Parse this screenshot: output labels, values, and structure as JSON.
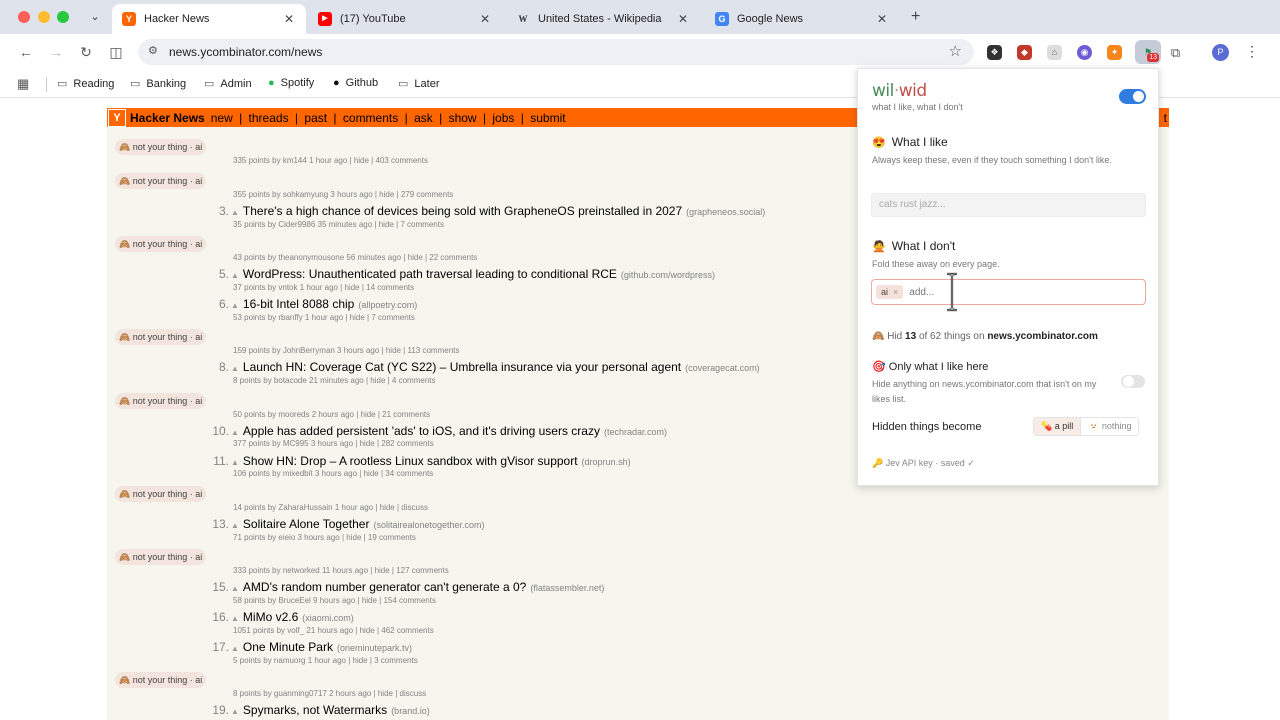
{
  "browser": {
    "tabs": [
      {
        "title": "Hacker News",
        "favicon": "Y",
        "favicon_color": "#ff6600",
        "active": true
      },
      {
        "title": "(17) YouTube",
        "favicon": "▶",
        "favicon_color": "#ff0000",
        "active": false
      },
      {
        "title": "United States - Wikipedia",
        "favicon": "W",
        "favicon_color": "#333333",
        "active": false
      },
      {
        "title": "Google News",
        "favicon": "G",
        "favicon_color": "#4285f4",
        "active": false
      }
    ],
    "url": "news.ycombinator.com/news",
    "bookmarks": [
      "Reading",
      "Banking",
      "Admin",
      "Spotify",
      "Github",
      "Later"
    ],
    "extension_badge": "13",
    "profile_initial": "P"
  },
  "hn": {
    "logo": "Y",
    "title": "Hacker News",
    "nav": [
      "new",
      "|",
      "threads",
      "|",
      "past",
      "|",
      "comments",
      "|",
      "ask",
      "|",
      "show",
      "|",
      "jobs",
      "|",
      "submit"
    ],
    "login": "t",
    "items": [
      {
        "pill": "🙈 not your thing · ai",
        "sub": "335 points by km144 1 hour ago | hide | 403 comments"
      },
      {
        "pill": "🙈 not your thing · ai",
        "sub": "355 points by sohkamyung 3 hours ago | hide | 279 comments"
      },
      {
        "rank": "3.",
        "title": "There's a high chance of devices being sold with GrapheneOS preinstalled in 2027",
        "domain": "(grapheneos.social)",
        "sub": "35 points by Cider9986 35 minutes ago | hide | 7 comments"
      },
      {
        "pill": "🙈 not your thing · ai",
        "sub": "43 points by theanonymousone 56 minutes ago | hide | 22 comments"
      },
      {
        "rank": "5.",
        "title": "WordPress: Unauthenticated path traversal leading to conditional RCE",
        "domain": "(github.com/wordpress)",
        "sub": "37 points by vntok 1 hour ago | hide | 14 comments"
      },
      {
        "rank": "6.",
        "title": "16-bit Intel 8088 chip",
        "domain": "(allpoetry.com)",
        "sub": "53 points by rbanffy 1 hour ago | hide | 7 comments"
      },
      {
        "pill": "🙈 not your thing · ai",
        "sub": "159 points by JohnBerryman 3 hours ago | hide | 113 comments"
      },
      {
        "rank": "8.",
        "title": "Launch HN: Coverage Cat (YC S22) – Umbrella insurance via your personal agent",
        "domain": "(coveragecat.com)",
        "sub": "8 points by botacode 21 minutes ago | hide | 4 comments"
      },
      {
        "pill": "🙈 not your thing · ai",
        "sub": "50 points by mooreds 2 hours ago | hide | 21 comments"
      },
      {
        "rank": "10.",
        "title": "Apple has added persistent 'ads' to iOS, and it's driving users crazy",
        "domain": "(techradar.com)",
        "sub": "377 points by MC995 3 hours ago | hide | 282 comments"
      },
      {
        "rank": "11.",
        "title": "Show HN: Drop – A rootless Linux sandbox with gVisor support",
        "domain": "(droprun.sh)",
        "sub": "106 points by mixedbit 3 hours ago | hide | 34 comments"
      },
      {
        "pill": "🙈 not your thing · ai",
        "sub": "14 points by ZaharaHussain 1 hour ago | hide | discuss"
      },
      {
        "rank": "13.",
        "title": "Solitaire Alone Together",
        "domain": "(solitairealonetogether.com)",
        "sub": "71 points by eieio 3 hours ago | hide | 19 comments"
      },
      {
        "pill": "🙈 not your thing · ai",
        "sub": "333 points by networked 11 hours ago | hide | 127 comments"
      },
      {
        "rank": "15.",
        "title": "AMD's random number generator can't generate a 0?",
        "domain": "(flatassembler.net)",
        "sub": "58 points by BruceEel 9 hours ago | hide | 154 comments"
      },
      {
        "rank": "16.",
        "title": "MiMo v2.6",
        "domain": "(xiaomi.com)",
        "sub": "1051 points by volf_ 21 hours ago | hide | 462 comments"
      },
      {
        "rank": "17.",
        "title": "One Minute Park",
        "domain": "(oneminutepark.tv)",
        "sub": "5 points by namuorg 1 hour ago | hide | 3 comments"
      },
      {
        "pill": "🙈 not your thing · ai",
        "sub": "8 points by guanming0717 2 hours ago | hide | discuss"
      },
      {
        "rank": "19.",
        "title": "Spymarks, not Watermarks",
        "domain": "(brand.io)",
        "sub": ""
      }
    ]
  },
  "popup": {
    "logo_a": "wil",
    "logo_dot": "·",
    "logo_b": "wid",
    "tagline": "what I like, what I don't",
    "enabled": true,
    "like": {
      "heading": "What I like",
      "emoji": "😍",
      "desc": "Always keep these, even if they touch something I don't like.",
      "placeholder": "cats rust jazz..."
    },
    "dislike": {
      "heading": "What I don't",
      "emoji": "🙅",
      "desc": "Fold these away on every page.",
      "chips": [
        "ai"
      ],
      "chip_remove": "×",
      "placeholder": "add..."
    },
    "hid": {
      "prefix": "Hid",
      "count": "13",
      "middle": "of 62 things on",
      "site": "news.ycombinator.com",
      "emoji": "🙈"
    },
    "only": {
      "heading": "Only what I like here",
      "emoji": "🎯",
      "desc": "Hide anything on news.ycombinator.com that isn't on my likes list.",
      "enabled": false
    },
    "hidden_become": {
      "label": "Hidden things become",
      "options": [
        "💊 a pill",
        "🫥 nothing"
      ],
      "selected": 0
    },
    "api": "🔑 Jev API key · saved ✓"
  },
  "colors": {
    "hn_orange": "#ff6600",
    "hn_bg": "#f6f6ef",
    "toggle_on": "#2f7de0",
    "pill_bg": "#f3e4dd",
    "focus_border": "#f0a8a0"
  }
}
